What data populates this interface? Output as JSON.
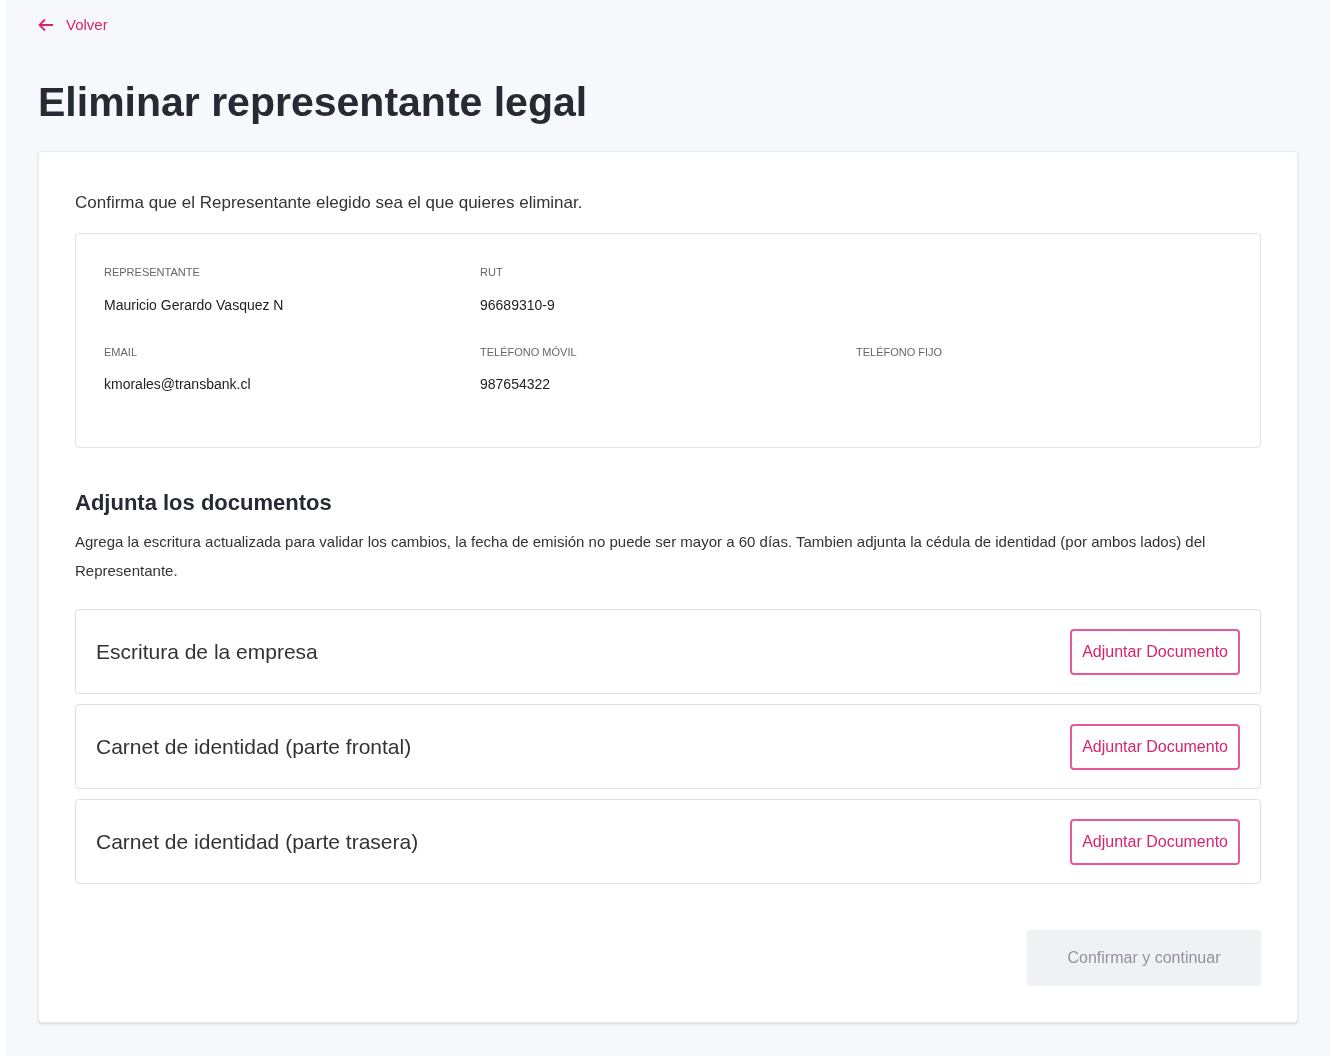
{
  "back_link": "Volver",
  "title": "Eliminar representante legal",
  "intro": "Confirma que el Representante elegido sea el que quieres eliminar.",
  "representative": {
    "fields": [
      {
        "label": "REPRESENTANTE",
        "value": "Mauricio Gerardo Vasquez N"
      },
      {
        "label": "RUT",
        "value": "96689310-9"
      },
      {
        "label": "EMAIL",
        "value": "kmorales@transbank.cl"
      },
      {
        "label": "TELÉFONO MÓVIL",
        "value": "987654322"
      },
      {
        "label": "TELÉFONO FIJO"
      }
    ]
  },
  "documents": {
    "heading": "Adjunta los documentos",
    "description": "Agrega la escritura actualizada para validar los cambios, la fecha de emisión no puede ser mayor a 60 días. Tambien adjunta la cédula de identidad (por ambos lados) del Representante.",
    "items": [
      {
        "label": "Escritura de la empresa",
        "button": "Adjuntar Documento"
      },
      {
        "label": "Carnet de identidad (parte frontal)",
        "button": "Adjuntar Documento"
      },
      {
        "label": "Carnet de identidad (parte trasera)",
        "button": "Adjuntar Documento"
      }
    ]
  },
  "confirm_button": {
    "label": "Confirmar y continuar",
    "disabled": true
  }
}
